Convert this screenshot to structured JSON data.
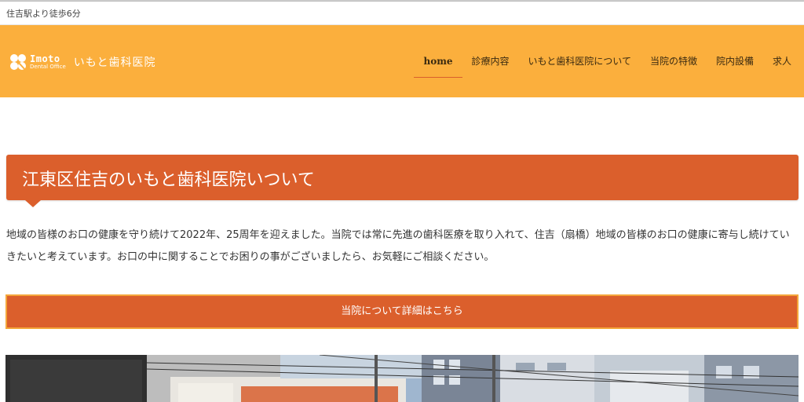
{
  "topbar": {
    "access_text": "住吉駅より徒歩6分"
  },
  "header": {
    "logo_en": "Imoto",
    "logo_sub": "Dental Office",
    "clinic_name": "いもと歯科医院",
    "brand_color": "#fbaf3d"
  },
  "nav": {
    "items": [
      {
        "label": "home",
        "active": true
      },
      {
        "label": "診療内容"
      },
      {
        "label": "いもと歯科医院について"
      },
      {
        "label": "当院の特徴"
      },
      {
        "label": "院内設備"
      },
      {
        "label": "求人"
      }
    ],
    "active_underline_color": "#d9602b"
  },
  "main": {
    "section_title": "江東区住吉のいもと歯科医院いついて",
    "paragraph": "地域の皆様のお口の健康を守り続けて2022年、25周年を迎えました。当院では常に先進の歯科医療を取り入れて、住吉（扇橋）地域の皆様のお口の健康に寄与し続けていきたいと考えています。お口の中に関することでお困りの事がございましたら、お気軽にご相談ください。",
    "cta_label": "当院について詳細はこちら",
    "accent_color": "#db5f2c"
  }
}
